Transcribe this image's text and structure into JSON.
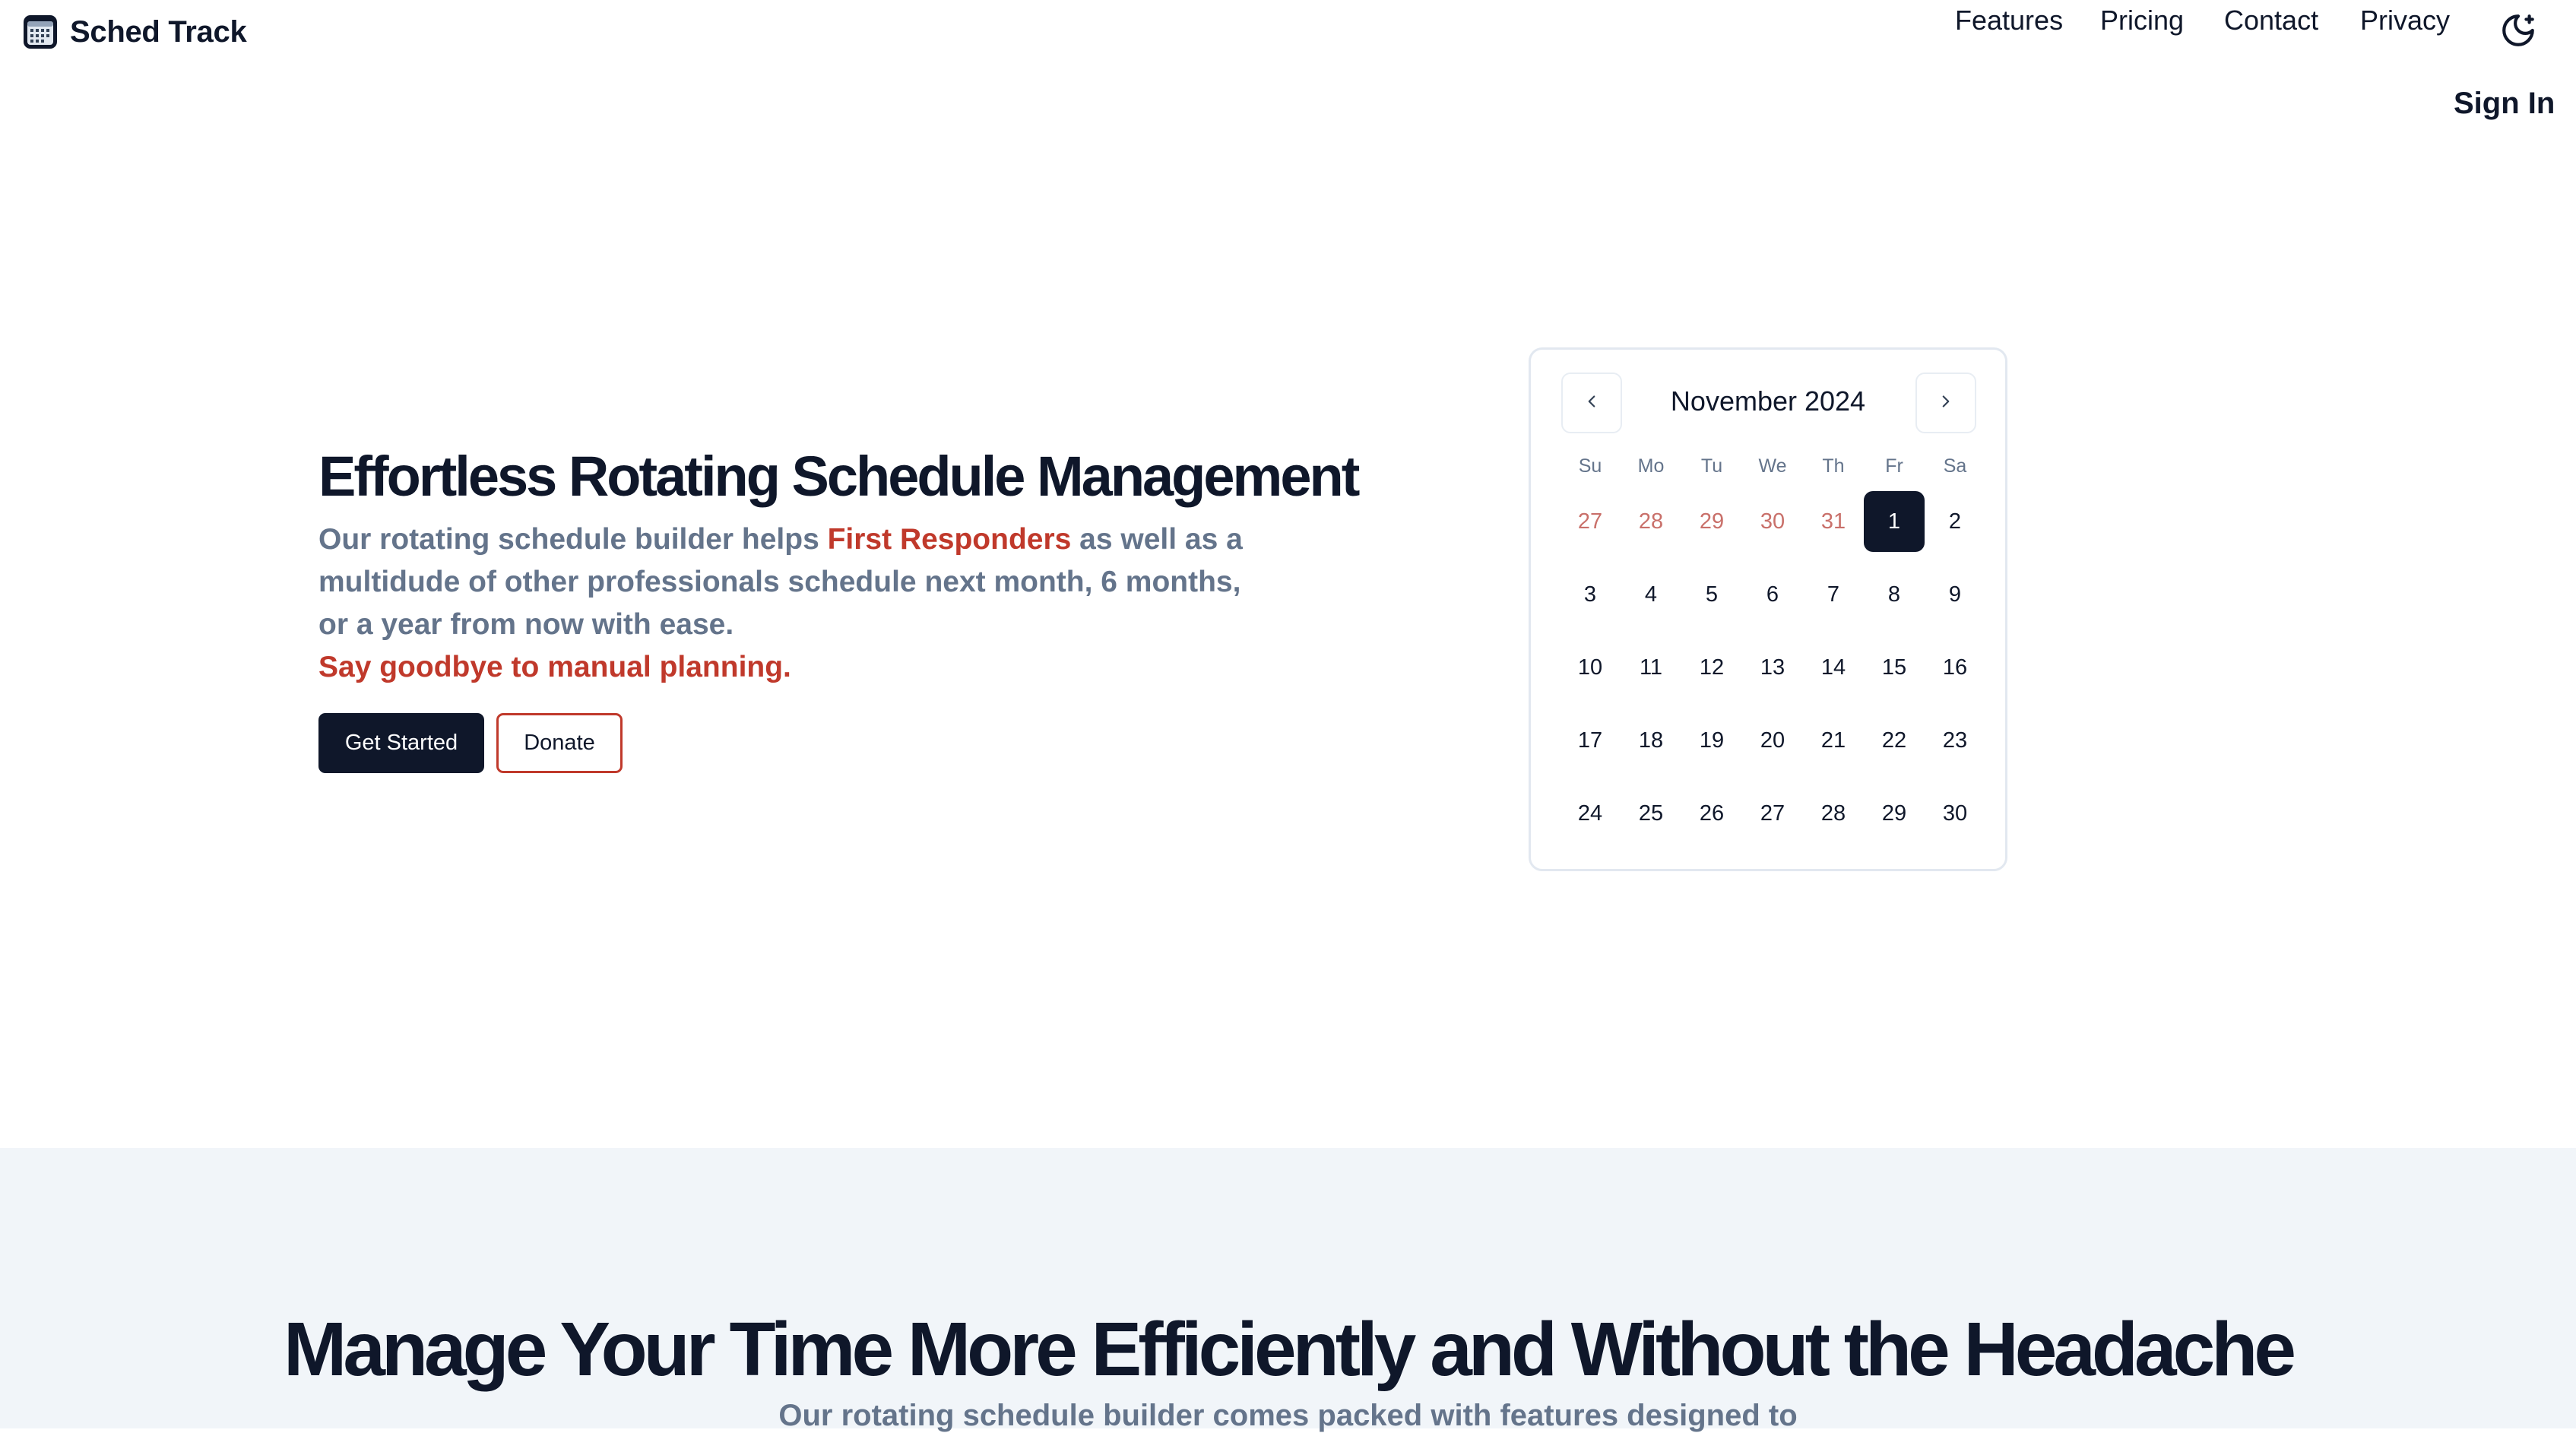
{
  "brand": {
    "name": "Sched Track",
    "icon": "calendar-icon"
  },
  "nav": {
    "links": [
      "Features",
      "Pricing",
      "Contact",
      "Privacy"
    ],
    "theme_icon": "moon-icon",
    "signin": "Sign In"
  },
  "hero": {
    "title": "Effortless Rotating Schedule Management",
    "copy_pre": "Our rotating schedule builder helps ",
    "copy_highlight": "First Responders",
    "copy_post": " as well as a multidude of other professionals schedule next month, 6 months, or a year from now with ease.",
    "tagline": "Say goodbye to manual planning.",
    "primary_button": "Get Started",
    "secondary_button": "Donate"
  },
  "calendar": {
    "month_label": "November 2024",
    "prev_icon": "chevron-left-icon",
    "next_icon": "chevron-right-icon",
    "weekdays": [
      "Su",
      "Mo",
      "Tu",
      "We",
      "Th",
      "Fr",
      "Sa"
    ],
    "weeks": [
      [
        "27",
        "28",
        "29",
        "30",
        "31",
        "1",
        "2"
      ],
      [
        "3",
        "4",
        "5",
        "6",
        "7",
        "8",
        "9"
      ],
      [
        "10",
        "11",
        "12",
        "13",
        "14",
        "15",
        "16"
      ],
      [
        "17",
        "18",
        "19",
        "20",
        "21",
        "22",
        "23"
      ],
      [
        "24",
        "25",
        "26",
        "27",
        "28",
        "29",
        "30"
      ]
    ],
    "selected_day": "1",
    "outside_day_color": "#c9706a",
    "accent_color": "#c0392b",
    "primary_color": "#0f172a"
  },
  "features": {
    "title": "Manage Your Time More Efficiently and Without the Headache",
    "subtitle": "Our rotating schedule builder comes packed with features designed to"
  }
}
